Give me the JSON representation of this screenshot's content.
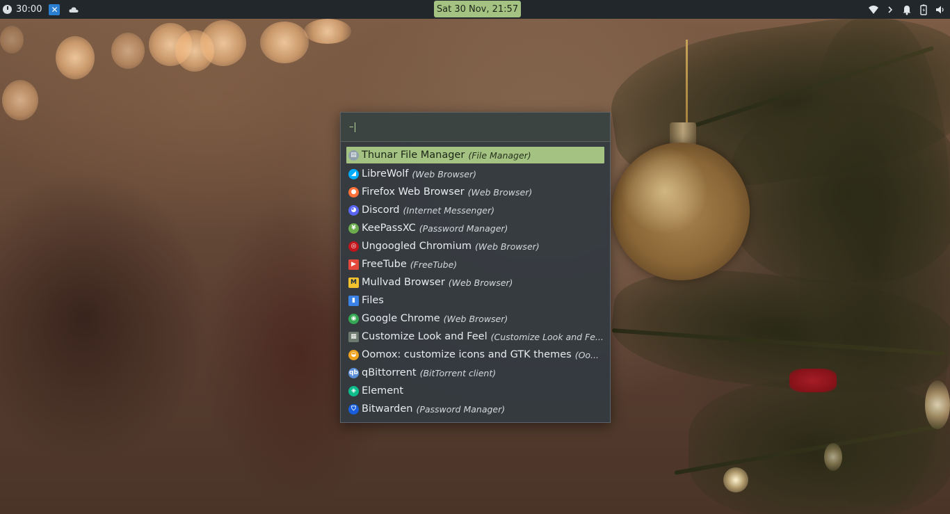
{
  "topbar": {
    "timer": "30:00",
    "datetime": "Sat 30 Nov, 21:57",
    "left_icons": [
      "clock-icon",
      "xfce-icon",
      "cloud-icon"
    ],
    "right_icons": [
      "wifi-icon",
      "chevron-right-icon",
      "bell-icon",
      "battery-icon",
      "volume-icon"
    ]
  },
  "launcher": {
    "search": {
      "prompt": "–",
      "value": "",
      "placeholder": ""
    },
    "items": [
      {
        "name": "Thunar File Manager",
        "category": "(File Manager)",
        "icon": "thunar-icon",
        "icon_color": "#8fa0ab",
        "selected": true
      },
      {
        "name": "LibreWolf",
        "category": "(Web Browser)",
        "icon": "librewolf-icon",
        "icon_color": "#00acff"
      },
      {
        "name": "Firefox Web Browser",
        "category": "(Web Browser)",
        "icon": "firefox-icon",
        "icon_color": "#ff7139"
      },
      {
        "name": "Discord",
        "category": "(Internet Messenger)",
        "icon": "discord-icon",
        "icon_color": "#5865f2"
      },
      {
        "name": "KeePassXC",
        "category": "(Password Manager)",
        "icon": "keepassxc-icon",
        "icon_color": "#6cac4d"
      },
      {
        "name": "Ungoogled Chromium",
        "category": "(Web Browser)",
        "icon": "ungoogled-chromium-icon",
        "icon_color": "#c2161c"
      },
      {
        "name": "FreeTube",
        "category": "(FreeTube)",
        "icon": "freetube-icon",
        "icon_color": "#e4483d"
      },
      {
        "name": "Mullvad Browser",
        "category": "(Web Browser)",
        "icon": "mullvad-icon",
        "icon_color": "#f2c12e"
      },
      {
        "name": "Files",
        "category": "",
        "icon": "files-icon",
        "icon_color": "#3b82e6"
      },
      {
        "name": "Google Chrome",
        "category": "(Web Browser)",
        "icon": "chrome-icon",
        "icon_color": "#34a853"
      },
      {
        "name": "Customize Look and Feel",
        "category": "(Customize Look and Fe...",
        "icon": "customize-icon",
        "icon_color": "#6d7a70"
      },
      {
        "name": "Oomox: customize icons and GTK themes",
        "category": "(Oo...",
        "icon": "oomox-icon",
        "icon_color": "#f0a31f"
      },
      {
        "name": "qBittorrent",
        "category": "(BitTorrent client)",
        "icon": "qbittorrent-icon",
        "icon_color": "#5a8fd8"
      },
      {
        "name": "Element",
        "category": "",
        "icon": "element-icon",
        "icon_color": "#0dbd8b"
      },
      {
        "name": "Bitwarden",
        "category": "(Password Manager)",
        "icon": "bitwarden-icon",
        "icon_color": "#175ddc"
      }
    ]
  },
  "colors": {
    "accent": "#a4c383",
    "panel": "#22272b",
    "launcher_bg": "#343a41"
  }
}
